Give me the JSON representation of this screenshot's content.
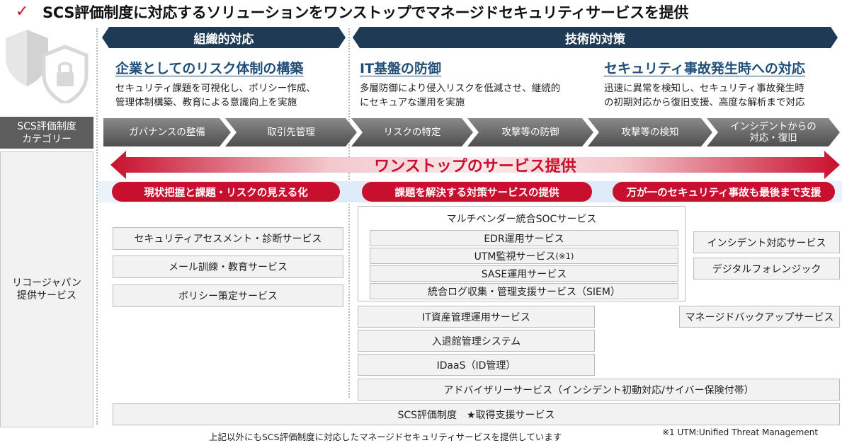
{
  "title": {
    "check": "✓",
    "text": "SCS評価制度に対応するソリューションをワンストップでマネージドセキュリティサービスを提供"
  },
  "banners": {
    "organizational": "組織的対応",
    "technical": "技術的対策"
  },
  "columns": [
    {
      "heading": "企業としてのリスク体制の構築",
      "description": "セキュリティ課題を可視化し、ポリシー作成、\n管理体制構築、教育による意識向上を実施"
    },
    {
      "heading": "IT基盤の防御",
      "description": "多層防御により侵入リスクを低減させ、継続的\nにセキュアな運用を実施"
    },
    {
      "heading": "セキュリティ事故発生時への対応",
      "description": "迅速に異常を検知し、セキュリティ事故発生時\nの初期対応から復旧支援、高度な解析まで対応"
    }
  ],
  "side_labels": {
    "category": "SCS評価制度\nカテゴリー",
    "services": "リコージャパン\n提供サービス"
  },
  "categories": [
    "ガバナンスの整備",
    "取引先管理",
    "リスクの特定",
    "攻撃等の防御",
    "攻撃等の検知",
    "インシデントからの\n対応・復旧"
  ],
  "onestop": "ワンストップのサービス提供",
  "pills": [
    "現状把握と課題・リスクの見える化",
    "課題を解決する対策サービスの提供",
    "万が一のセキュリティ事故も最後まで支援"
  ],
  "services": {
    "left": [
      "セキュリティアセスメント・診断サービス",
      "メール訓練・教育サービス",
      "ポリシー策定サービス"
    ],
    "soc_group": "マルチベンダー統合SOCサービス",
    "soc_items": {
      "edr": "EDR運用サービス",
      "utm": "UTM監視サービス",
      "utm_note": "(※1)",
      "sase": "SASE運用サービス",
      "siem": "統合ログ収集・管理支援サービス（SIEM）"
    },
    "middle": [
      "IT資産管理運用サービス",
      "入退館管理システム",
      "IDaaS（ID管理）"
    ],
    "right": [
      "インシデント対応サービス",
      "デジタルフォレンジック",
      "マネージドバックアップサービス"
    ],
    "advisory": "アドバイザリーサービス（インシデント初動対応/サイバー保険付帯）",
    "scs_support": "SCS評価制度　★取得支援サービス"
  },
  "footer": {
    "note": "上記以外にもSCS評価制度に対応したマネージドセキュリティサービスを提供しています",
    "reference": "※1 UTM:Unified Threat Management"
  },
  "colors": {
    "navy": "#1f3a55",
    "heading_blue": "#1f4e79",
    "accent_red": "#c8102e",
    "chevron_gray": "#5d5d5d"
  }
}
